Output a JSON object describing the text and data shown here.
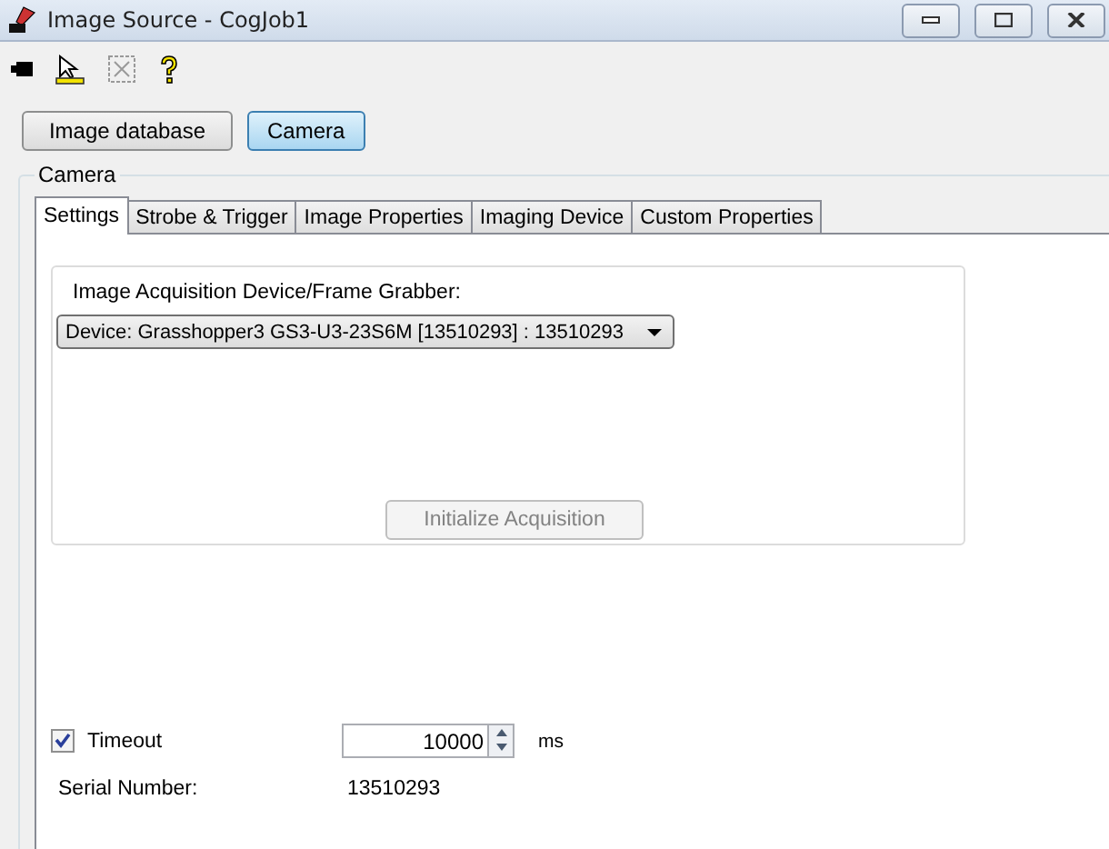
{
  "window": {
    "title": "Image Source - CogJob1"
  },
  "toolbar": [
    {
      "kind": "camera",
      "disabled": false
    },
    {
      "kind": "pointer",
      "disabled": false
    },
    {
      "kind": "crop",
      "disabled": true
    },
    {
      "kind": "help",
      "disabled": false
    }
  ],
  "source_buttons": [
    {
      "label": "Image database",
      "selected": false
    },
    {
      "label": "Camera",
      "selected": true
    }
  ],
  "group": {
    "title": "Camera"
  },
  "tabs": [
    {
      "label": "Settings",
      "selected": true
    },
    {
      "label": "Strobe & Trigger",
      "selected": false
    },
    {
      "label": "Image Properties",
      "selected": false
    },
    {
      "label": "Imaging Device",
      "selected": false
    },
    {
      "label": "Custom Properties",
      "selected": false
    }
  ],
  "device": {
    "label": "Image Acquisition Device/Frame Grabber:",
    "value": "Device: Grasshopper3 GS3-U3-23S6M [13510293] : 13510293",
    "init_button": {
      "label": "Initialize Acquisition",
      "disabled": true
    }
  },
  "timeout": {
    "label": "Timeout",
    "checked": true,
    "value": "10000",
    "unit": "ms"
  },
  "serial": {
    "label": "Serial Number:",
    "value": "13510293"
  }
}
